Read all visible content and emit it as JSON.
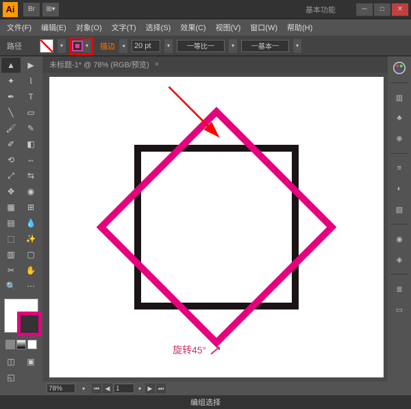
{
  "app": {
    "logo": "Ai",
    "workspace": "基本功能"
  },
  "menu": {
    "file": "文件(F)",
    "edit": "编辑(E)",
    "object": "对象(O)",
    "type": "文字(T)",
    "select": "选择(S)",
    "effect": "效果(C)",
    "view": "视图(V)",
    "window": "窗口(W)",
    "help": "帮助(H)"
  },
  "control": {
    "label": "路径",
    "stroke_label": "描边",
    "stroke_pt": "20 pt",
    "profile": "等比",
    "brush": "基本"
  },
  "tab": {
    "title": "未标题-1* @ 78% (RGB/预览)",
    "close": "×"
  },
  "annotation": {
    "rotate": "旋转45°"
  },
  "footer": {
    "zoom": "78%",
    "page": "1"
  },
  "status": {
    "text": "编组选择"
  },
  "colors": {
    "accent_pink": "#e6007e",
    "accent_orange": "#ff8800",
    "arrow_red": "#ff0000"
  }
}
